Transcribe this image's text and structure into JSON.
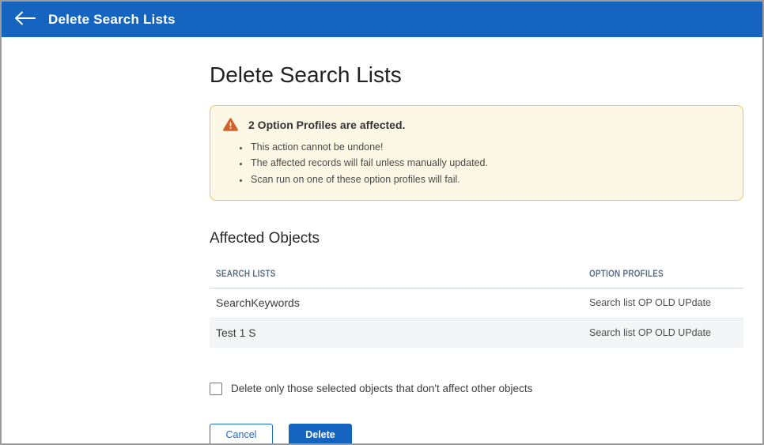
{
  "header": {
    "title": "Delete Search Lists"
  },
  "page": {
    "title": "Delete Search Lists"
  },
  "warning": {
    "title": "2 Option Profiles are affected.",
    "bullets": [
      "This action cannot be undone!",
      "The affected records will fail unless manually updated.",
      "Scan run on one of these option profiles will fail."
    ]
  },
  "affected_objects": {
    "title": "Affected Objects",
    "columns": [
      "SEARCH LISTS",
      "OPTION PROFILES"
    ],
    "rows": [
      {
        "search_list": "SearchKeywords",
        "option_profile": "Search list OP OLD UPdate"
      },
      {
        "search_list": "Test 1 S",
        "option_profile": "Search list OP OLD UPdate"
      }
    ]
  },
  "checkbox": {
    "label": "Delete only those selected objects that don't affect other objects",
    "checked": false
  },
  "actions": {
    "cancel_label": "Cancel",
    "delete_label": "Delete"
  },
  "colors": {
    "header_blue": "#1565C0",
    "primary_blue": "#1565C0",
    "warning_bg": "#FDF8E5",
    "warning_border": "#E9C94E",
    "warning_icon_orange": "#D2622A",
    "table_header_text": "#5D7186",
    "row_alt_bg": "#F4F5F6"
  }
}
